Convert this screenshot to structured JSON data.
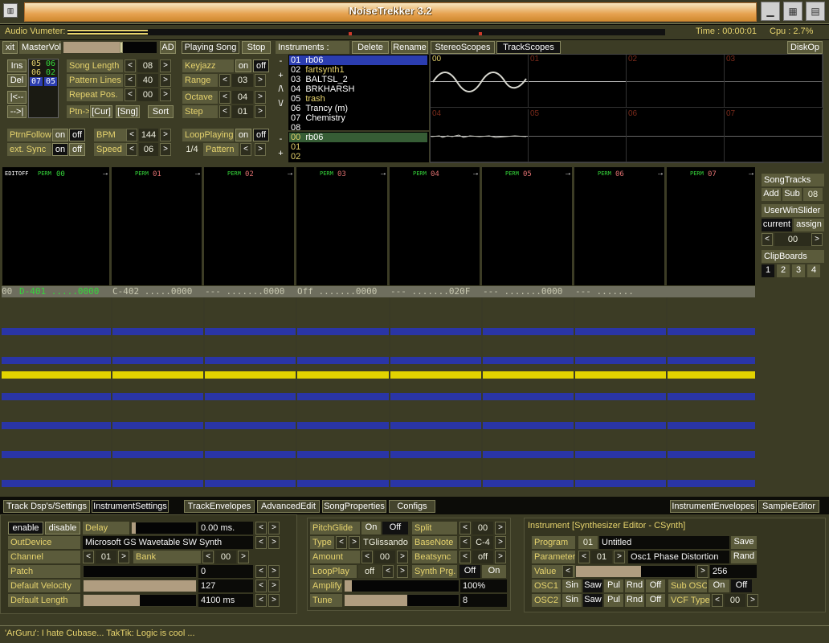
{
  "window": {
    "title": "NoiseTrekker 3.2",
    "left_icon": "app-icon",
    "right_icons": [
      "minimize-icon",
      "maximize-icon",
      "close-icon"
    ]
  },
  "vumeter": {
    "label": "Audio Vumeter:",
    "time": "Time : 00:00:01",
    "cpu": "Cpu : 2.7%"
  },
  "top": {
    "xit": "xit",
    "mastervol": "MasterVol",
    "ad": "AD",
    "playing_song": "Playing Song",
    "stop": "Stop"
  },
  "transport": {
    "ins": "Ins",
    "del": "Del",
    "left": "|<--",
    "right": "-->|",
    "pos_cols": [
      [
        "05",
        "06",
        "07"
      ],
      [
        "06",
        "02",
        "05"
      ]
    ],
    "song_length": {
      "label": "Song Length",
      "value": "08"
    },
    "pattern_lines": {
      "label": "Pattern Lines",
      "value": "40"
    },
    "repeat_pos": {
      "label": "Repeat Pos.",
      "value": "00"
    },
    "ptn": "Ptn->",
    "cur": "[Cur]",
    "sng": "[Sng]",
    "sort": "Sort",
    "keyjazz": {
      "label": "Keyjazz",
      "on": "on",
      "off": "off"
    },
    "range": {
      "label": "Range",
      "value": "03"
    },
    "octave": {
      "label": "Octave",
      "value": "04"
    },
    "step": {
      "label": "Step",
      "value": "01"
    },
    "ptrnfollow": {
      "label": "PtrnFollow",
      "on": "on",
      "off": "off"
    },
    "extsync": {
      "label": "ext. Sync",
      "on": "on",
      "off": "off"
    },
    "bpm": {
      "label": "BPM",
      "value": "144"
    },
    "speed": {
      "label": "Speed",
      "value": "06"
    },
    "loopplaying": {
      "label": "LoopPlaying",
      "on": "on",
      "off": "off"
    },
    "pattern": {
      "prefix": "1/4",
      "label": "Pattern"
    }
  },
  "instruments": {
    "label": "Instruments :",
    "delete": "Delete",
    "rename": "Rename",
    "list": [
      {
        "num": "01",
        "name": "rb06",
        "sel": true
      },
      {
        "num": "02",
        "name": "fartsynth1",
        "c": "#e6d36d"
      },
      {
        "num": "03",
        "name": "BALTSL_2"
      },
      {
        "num": "04",
        "name": "BRKHARSH"
      },
      {
        "num": "05",
        "name": "trash",
        "c": "#e6d36d"
      },
      {
        "num": "06",
        "name": "Trancy (m)"
      },
      {
        "num": "07",
        "name": "Chemistry"
      },
      {
        "num": "08",
        "name": ""
      }
    ],
    "list2": [
      {
        "num": "00",
        "name": "rb06",
        "sel": true
      },
      {
        "num": "01",
        "name": ""
      },
      {
        "num": "02",
        "name": ""
      }
    ],
    "side_buttons": [
      "-",
      "+",
      "/\\",
      "\\/",
      "-",
      "+"
    ]
  },
  "scopes": {
    "stereo": "StereoScopes",
    "track": "TrackScopes",
    "diskop": "DiskOp",
    "nums": [
      "00",
      "01",
      "02",
      "03",
      "04",
      "05",
      "06",
      "07"
    ]
  },
  "tracks": {
    "edit": "EDITOFF",
    "labels": [
      "00",
      "01",
      "02",
      "03",
      "04",
      "05",
      "06",
      "07"
    ],
    "perm": "PERM",
    "header_row": [
      "00",
      "D-401 .....0000",
      "C-402 .....0000",
      "--- .......0000",
      "Off .......0000",
      "--- .......020F",
      "--- .......0000",
      "--- ......."
    ]
  },
  "songtracks": {
    "title": "SongTracks",
    "add": "Add",
    "sub": "Sub",
    "value": "08",
    "userwin": "UserWinSlider",
    "current": "current",
    "assign": "assign",
    "uv": "00",
    "clipboards": "ClipBoards",
    "clips": [
      "1",
      "2",
      "3",
      "4"
    ]
  },
  "tabs": [
    "Track Dsp's/Settings",
    "InstrumentSettings",
    "TrackEnvelopes",
    "AdvancedEdit",
    "SongProperties",
    "Configs",
    "InstrumentEnvelopes",
    "SampleEditor"
  ],
  "inst_settings": {
    "enable": "enable",
    "disable": "disable",
    "delay": "Delay",
    "delay_val": "0.00 ms.",
    "outdevice": "OutDevice",
    "outdevice_val": "Microsoft GS Wavetable SW Synth",
    "channel": "Channel",
    "channel_val": "01",
    "bank": "Bank",
    "bank_val": "00",
    "patch": "Patch",
    "patch_val": "0",
    "defvel": "Default Velocity",
    "defvel_val": "127",
    "deflen": "Default Length",
    "deflen_val": "4100 ms",
    "delay_level": 0.06,
    "patch_level": 0.0,
    "defvel_level": 1.0,
    "deflen_level": 0.5
  },
  "synth_mid": {
    "pitchglide": "PitchGlide",
    "on": "On",
    "off": "Off",
    "split": "Split",
    "split_val": "00",
    "type": "Type",
    "type_val": "TGlissando",
    "basenote": "BaseNote",
    "basenote_val": "C-4",
    "amount": "Amount",
    "amount_val": "00",
    "beatsync": "Beatsync",
    "beatsync_val": "off",
    "loopplay": "LoopPlay",
    "loopplay_val": "off",
    "synthprg": "Synth Prg.",
    "sp_off": "Off",
    "sp_on": "On",
    "amplify": "Amplify",
    "amplify_val": "100%",
    "tune": "Tune",
    "tune_val": "8",
    "amplify_level": 0.06,
    "tune_level": 0.55
  },
  "synth": {
    "title": "Instrument [Synthesizer Editor - CSynth]",
    "program": "Program",
    "program_num": "01",
    "program_name": "Untitled",
    "save": "Save",
    "parameter": "Parameter",
    "param_num": "01",
    "param_name": "Osc1 Phase Distortion",
    "rand": "Rand",
    "value": "Value",
    "value_val": "256",
    "value_level": 0.55,
    "osc1": "OSC1",
    "osc2": "OSC2",
    "waves": [
      "Sin",
      "Saw",
      "Pul",
      "Rnd",
      "Off"
    ],
    "subosc": "Sub OSC",
    "sub_on": "On",
    "sub_off": "Off",
    "vcftype": "VCF Type",
    "vcf_val": "00"
  },
  "status": "'ArGuru': I hate Cubase... TakTik: Logic is cool ..."
}
